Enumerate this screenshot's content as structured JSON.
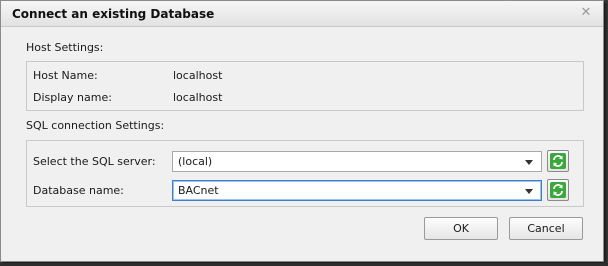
{
  "dialog": {
    "title": "Connect an existing Database",
    "close_glyph": "✕"
  },
  "host_settings": {
    "heading": "Host Settings:",
    "host_name_label": "Host Name:",
    "host_name_value": "localhost",
    "display_name_label": "Display name:",
    "display_name_value": "localhost"
  },
  "sql_settings": {
    "heading": "SQL connection Settings:",
    "server_label": "Select the SQL server:",
    "server_value": "(local)",
    "database_label": "Database name:",
    "database_value": "BACnet"
  },
  "buttons": {
    "ok": "OK",
    "cancel": "Cancel"
  },
  "colors": {
    "refresh_icon": "#3aa83a",
    "focus_border": "#3a7fd0"
  }
}
